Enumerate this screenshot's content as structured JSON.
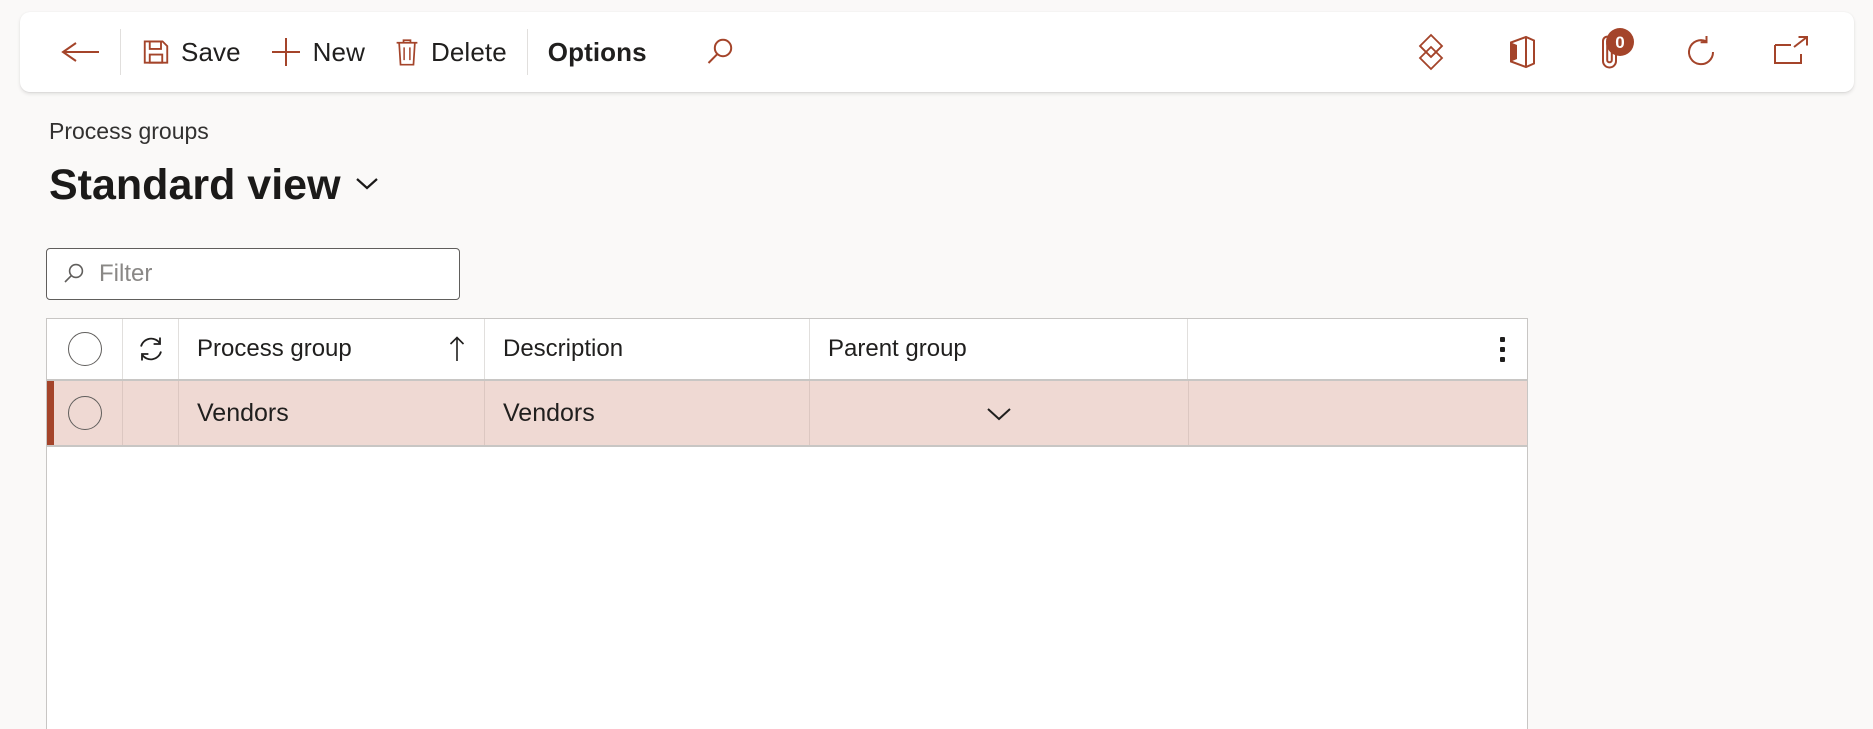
{
  "toolbar": {
    "back": {
      "label": "",
      "icon": "back-arrow-icon"
    },
    "save": {
      "label": "Save",
      "icon": "save-icon"
    },
    "new": {
      "label": "New",
      "icon": "plus-icon"
    },
    "delete": {
      "label": "Delete",
      "icon": "trash-icon"
    },
    "options": {
      "label": "Options"
    },
    "search": {
      "icon": "search-icon"
    },
    "right_icons": [
      {
        "name": "diamond-icon",
        "label": ""
      },
      {
        "name": "office-icon",
        "label": ""
      },
      {
        "name": "attachment-icon",
        "label": "",
        "badge": "0"
      },
      {
        "name": "refresh-icon",
        "label": ""
      },
      {
        "name": "open-in-new-window-icon",
        "label": ""
      }
    ]
  },
  "page": {
    "breadcrumb": "Process groups",
    "title": "Standard view"
  },
  "filter": {
    "placeholder": "Filter",
    "value": ""
  },
  "grid": {
    "columns": [
      {
        "key": "select",
        "label": ""
      },
      {
        "key": "refresh",
        "label": ""
      },
      {
        "key": "process_group",
        "label": "Process group",
        "sort": "ascending"
      },
      {
        "key": "description",
        "label": "Description"
      },
      {
        "key": "parent_group",
        "label": "Parent group"
      }
    ],
    "rows": [
      {
        "process_group": "Vendors",
        "description": "Vendors",
        "parent_group": "",
        "selected": true
      }
    ]
  },
  "colors": {
    "accent": "#a4442a",
    "selected_row_bg": "#efd9d3",
    "page_bg": "#faf9f8",
    "text": "#201f1e"
  }
}
